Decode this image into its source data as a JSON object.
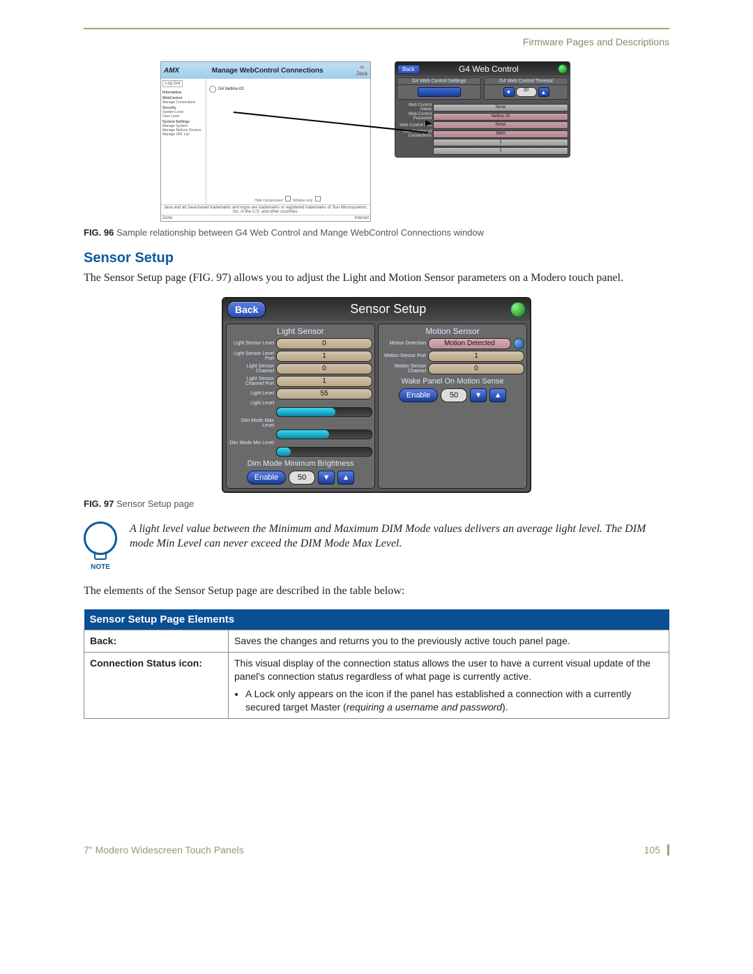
{
  "header": {
    "right": "Firmware Pages and Descriptions"
  },
  "fig96": {
    "webcontrol": {
      "title": "Manage WebControl Connections",
      "java": "Java",
      "logout": "Log Out",
      "side_groups": [
        "Information",
        "WebControl",
        "Manage Connections",
        "Security",
        "System Level",
        "User Level",
        "System Settings",
        "Manage System",
        "Manage NetLinx Devices",
        "Manage URL List"
      ],
      "main_item": "G4 Netlinx-03",
      "footer_left": "Hide Compressed",
      "footer_right": "Window only",
      "status_left": "Done",
      "status_right": "Internet",
      "legal": "Java and all Java-based trademarks and logos are trademarks or registered trademarks of Sun Microsystems, Inc. in the U.S. and other countries."
    },
    "g4": {
      "back": "Back",
      "title": "G4 Web Control",
      "col1_title": "G4 Web Control Settings",
      "col2_title": "G4 Web Control Timeout",
      "timeout_value": "30",
      "rows": [
        {
          "label": "Web Control Name",
          "val": "None"
        },
        {
          "label": "Web Control Password",
          "val": "Netlinx 03"
        },
        {
          "label": "Web Control Port",
          "val": "None"
        },
        {
          "label": "Max Number of Connections",
          "val": "5900"
        },
        {
          "label": "",
          "val": "1"
        },
        {
          "label": "",
          "val": "1"
        }
      ]
    },
    "caption_label": "FIG. 96",
    "caption": "Sample relationship between G4 Web Control and Mange WebControl Connections window"
  },
  "section": {
    "title": "Sensor Setup",
    "intro": "The Sensor Setup page (FIG. 97) allows you to adjust the Light and Motion Sensor parameters on a Modero touch panel."
  },
  "fig97": {
    "back": "Back",
    "title": "Sensor Setup",
    "left": {
      "title": "Light Sensor",
      "rows": [
        {
          "label": "Light Sensor Level",
          "val": "0"
        },
        {
          "label": "Light Sensor Level Port",
          "val": "1"
        },
        {
          "label": "Light Sensor Channel",
          "val": "0"
        },
        {
          "label": "Light Sensor Channel Port",
          "val": "1"
        },
        {
          "label": "Light Level",
          "val": "55"
        }
      ],
      "slider_labels": [
        "Light Level",
        "Dim Mode Max Level",
        "Dim Mode Min Level"
      ],
      "dim_subhead": "Dim Mode Minimum Brightness",
      "enable": "Enable",
      "value": "50"
    },
    "right": {
      "title": "Motion Sensor",
      "rows": [
        {
          "label": "Motion Detection",
          "val": "Motion Detected"
        },
        {
          "label": "Motion Sensor Port",
          "val": "1"
        },
        {
          "label": "Motion Sensor Channel",
          "val": "0"
        }
      ],
      "wake_subhead": "Wake Panel On Motion Sense",
      "enable": "Enable",
      "value": "50"
    },
    "caption_label": "FIG. 97",
    "caption": "Sensor Setup page"
  },
  "note": {
    "label": "NOTE",
    "text": "A light level value between the Minimum and Maximum DIM Mode values delivers an average light level. The DIM mode Min Level can never exceed the DIM Mode Max Level."
  },
  "table_intro": "The elements of the Sensor Setup page are described in the table below:",
  "table": {
    "header": "Sensor Setup Page Elements",
    "rows": [
      {
        "label": "Back:",
        "desc": "Saves the changes and returns you to the previously active touch panel page."
      },
      {
        "label": "Connection Status icon:",
        "desc": "This visual display of the connection status allows the user to have a current visual update of the panel's connection status regardless of what page is currently active.",
        "bullet": "A Lock only appears on the icon if the panel has established a connection with a currently secured target Master (",
        "bullet_em": "requiring a username and password",
        "bullet_tail": ")."
      }
    ]
  },
  "footer": {
    "left": "7\" Modero Widescreen Touch Panels",
    "page": "105"
  }
}
